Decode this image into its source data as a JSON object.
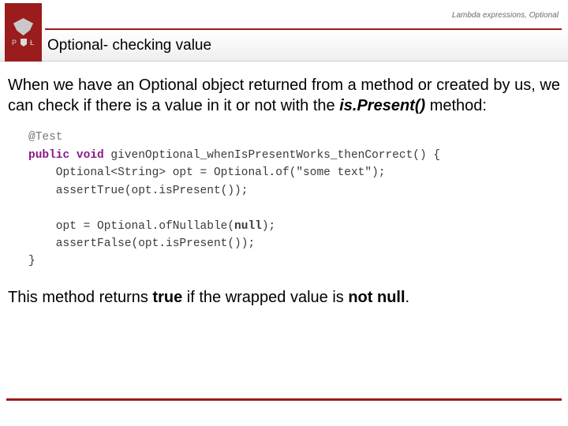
{
  "header": {
    "breadcrumb": "Lambda expressions, Optional",
    "logo_letter_left": "P",
    "logo_letter_right": "Ł"
  },
  "slide": {
    "title": "Optional- checking value",
    "para1_a": "When we have an Optional object returned from a method or created by us, we can check if there is a value in it or not with the ",
    "para1_method": "is.Present()",
    "para1_b": " method:",
    "para2_a": "This method returns ",
    "para2_true": "true",
    "para2_b": " if the wrapped value is ",
    "para2_notnull": "not null",
    "para2_c": "."
  },
  "code": {
    "l1": "@Test",
    "l2_kw": "public void",
    "l2_rest": " givenOptional_whenIsPresentWorks_thenCorrect() {",
    "l3": "    Optional<String> opt = Optional.of(\"some text\");",
    "l4": "    assertTrue(opt.isPresent());",
    "l5": "",
    "l6a": "    opt = Optional.ofNullable(",
    "l6null": "null",
    "l6b": ");",
    "l7": "    assertFalse(opt.isPresent());",
    "l8": "}"
  }
}
